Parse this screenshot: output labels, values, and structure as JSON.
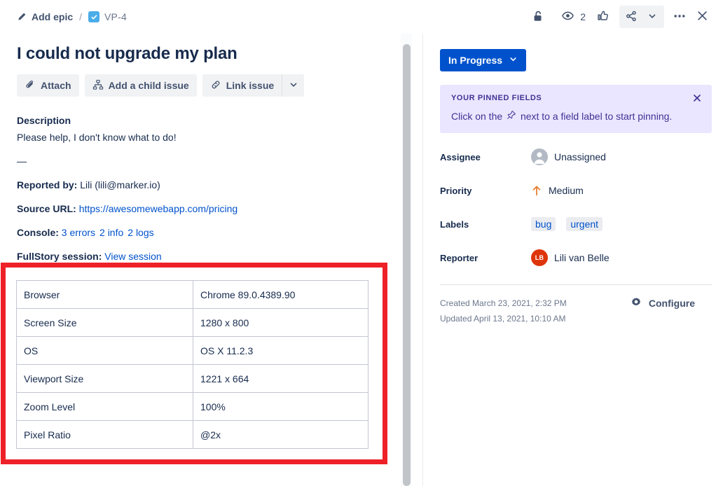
{
  "breadcrumb": {
    "epic_label": "Add epic",
    "separator": "/",
    "issue_key": "VP-4",
    "epic_icon": "pencil-icon",
    "issue_icon": "task-check-icon"
  },
  "topbar": {
    "lock_icon": "unlocked-padlock-icon",
    "watch_icon": "eye-icon",
    "watch_count": "2",
    "vote_icon": "thumbs-up-icon",
    "share_icon": "share-icon",
    "share_chevron_icon": "chevron-down-icon",
    "more_icon": "more-horizontal-icon",
    "close_icon": "close-icon"
  },
  "issue": {
    "title": "I could not upgrade my plan",
    "actions": [
      {
        "label": "Attach",
        "icon": "paperclip-icon"
      },
      {
        "label": "Add a child issue",
        "icon": "child-issue-icon"
      },
      {
        "label": "Link issue",
        "icon": "link-icon"
      }
    ],
    "actions_more_icon": "chevron-down-icon"
  },
  "description": {
    "heading": "Description",
    "body": "Please help, I don't know what to do!",
    "divider": "—",
    "reported_by_label": "Reported by:",
    "reported_by_value": "Lili (lili@marker.io)",
    "source_url_label": "Source URL:",
    "source_url_value": "https://awesomewebapp.com/pricing",
    "console_label": "Console:",
    "console_links": [
      "3 errors",
      "2 info",
      "2 logs"
    ],
    "fullstory_label": "FullStory session:",
    "fullstory_link": "View session"
  },
  "env_table": {
    "rows": [
      {
        "key": "Browser",
        "value": "Chrome 89.0.4389.90"
      },
      {
        "key": "Screen Size",
        "value": "1280 x 800"
      },
      {
        "key": "OS",
        "value": "OS X 11.2.3"
      },
      {
        "key": "Viewport Size",
        "value": "1221 x 664"
      },
      {
        "key": "Zoom Level",
        "value": "100%"
      },
      {
        "key": "Pixel Ratio",
        "value": "@2x"
      }
    ],
    "highlight_color": "#ee2129"
  },
  "sidebar": {
    "status": {
      "label": "In Progress",
      "chevron_icon": "chevron-down-icon",
      "color": "#0052cc"
    },
    "pinned": {
      "heading": "YOUR PINNED FIELDS",
      "text_before": "Click on the",
      "pin_icon": "pin-icon",
      "text_after": "next to a field label to start pinning.",
      "close_icon": "close-icon",
      "background": "#eae6ff",
      "text_color": "#403294"
    },
    "fields": [
      {
        "label": "Assignee",
        "value": "Unassigned",
        "icon": "user-avatar-icon"
      },
      {
        "label": "Priority",
        "value": "Medium",
        "icon": "priority-medium-arrow-icon",
        "icon_color": "#e97f33"
      },
      {
        "label": "Labels",
        "chips": [
          "bug",
          "urgent"
        ]
      },
      {
        "label": "Reporter",
        "value": "Lili van Belle",
        "avatar_initials": "LB",
        "avatar_color": "#de350b"
      }
    ],
    "footer": {
      "created": "Created March 23, 2021, 2:32 PM",
      "updated": "Updated April 13, 2021, 10:10 AM",
      "configure_label": "Configure",
      "configure_icon": "gear-icon"
    }
  }
}
